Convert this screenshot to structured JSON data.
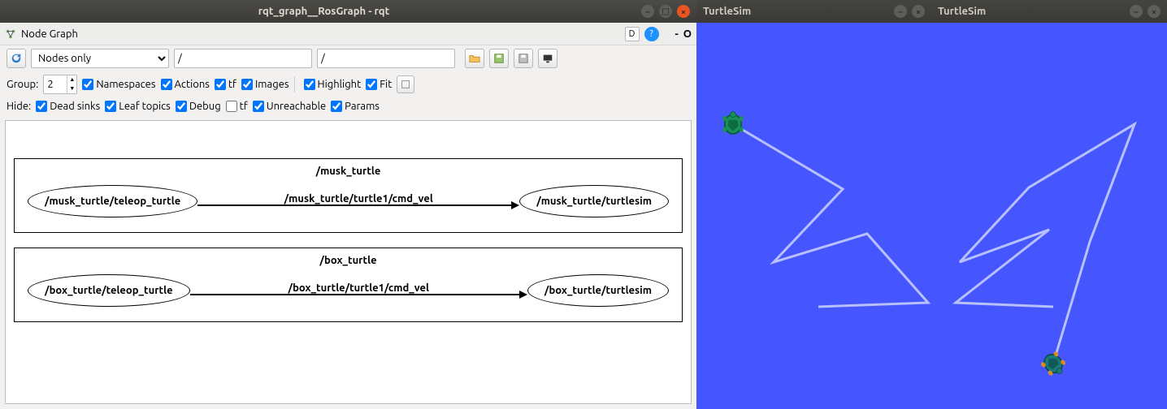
{
  "rqt": {
    "window_title": "rqt_graph__RosGraph - rqt",
    "panel_title": "Node Graph",
    "d_btn": "D",
    "minus": "-",
    "o_btn": "O",
    "refresh_tooltip": "Refresh",
    "view_mode": "Nodes only",
    "path1": "/",
    "path2": "/",
    "group_label": "Group:",
    "group_value": "2",
    "cb_namespaces": "Namespaces",
    "cb_actions": "Actions",
    "cb_tf": "tf",
    "cb_images": "Images",
    "cb_highlight": "Highlight",
    "cb_fit": "Fit",
    "hide_label": "Hide:",
    "cb_dead": "Dead sinks",
    "cb_leaf": "Leaf topics",
    "cb_debug": "Debug",
    "cb_tf2": "tf",
    "cb_unreach": "Unreachable",
    "cb_params": "Params",
    "graph": {
      "ns1": {
        "title": "/musk_turtle",
        "node_left": "/musk_turtle/teleop_turtle",
        "edge": "/musk_turtle/turtle1/cmd_vel",
        "node_right": "/musk_turtle/turtlesim"
      },
      "ns2": {
        "title": "/box_turtle",
        "node_left": "/box_turtle/teleop_turtle",
        "edge": "/box_turtle/turtle1/cmd_vel",
        "node_right": "/box_turtle/turtlesim"
      }
    }
  },
  "turtlesim1": {
    "title": "TurtleSim"
  },
  "turtlesim2": {
    "title": "TurtleSim"
  },
  "colors": {
    "turtlesim_bg": "#4556ff",
    "trail": "#b9c0ff"
  }
}
